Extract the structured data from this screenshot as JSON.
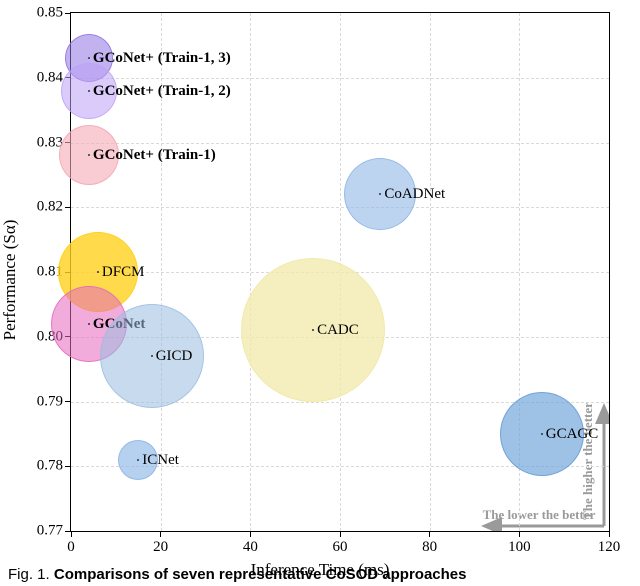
{
  "axes": {
    "xlabel": "Inference Time (ms)",
    "ylabel": "Performance (Sα)",
    "xlim": [
      0,
      120
    ],
    "ylim": [
      0.77,
      0.85
    ],
    "xticks": [
      0,
      20,
      40,
      60,
      80,
      100,
      120
    ],
    "yticks": [
      0.77,
      0.78,
      0.79,
      0.8,
      0.81,
      0.82,
      0.83,
      0.84,
      0.85
    ]
  },
  "hints": {
    "right_up": "The higher the better",
    "right_down": "The lower the better"
  },
  "caption": {
    "prefix": "Fig. 1.",
    "text": "Comparisons of seven representative CoSOD approaches"
  },
  "chart_data": {
    "type": "scatter",
    "title": "",
    "xlabel": "Inference Time (ms)",
    "ylabel": "Performance (Sα)",
    "xlim": [
      0,
      120
    ],
    "ylim": [
      0.77,
      0.85
    ],
    "grid": true,
    "legend": false,
    "series": [
      {
        "name": "GCoNet+ (Train-1, 3)",
        "x": 4,
        "y": 0.843,
        "radius_px": 24,
        "fill": "#8f72e3",
        "alpha": 0.55,
        "label_bold": true,
        "label_dx": 4,
        "label_dy": 0
      },
      {
        "name": "GCoNet+ (Train-1, 2)",
        "x": 4,
        "y": 0.838,
        "radius_px": 28,
        "fill": "#bda1f6",
        "alpha": 0.55,
        "label_bold": true,
        "label_dx": 4,
        "label_dy": 0
      },
      {
        "name": "GCoNet+ (Train-1)",
        "x": 4,
        "y": 0.828,
        "radius_px": 30,
        "fill": "#f5a8b6",
        "alpha": 0.6,
        "label_bold": true,
        "label_dx": 4,
        "label_dy": 0
      },
      {
        "name": "CoADNet",
        "x": 69,
        "y": 0.822,
        "radius_px": 36,
        "fill": "#8fb7e6",
        "alpha": 0.6,
        "label_bold": false,
        "label_dx": 4,
        "label_dy": 0
      },
      {
        "name": "DFCM",
        "x": 6,
        "y": 0.81,
        "radius_px": 40,
        "fill": "#ffd21f",
        "alpha": 0.8,
        "label_bold": false,
        "label_dx": 4,
        "label_dy": 0
      },
      {
        "name": "GCoNet",
        "x": 4,
        "y": 0.802,
        "radius_px": 38,
        "fill": "#e667c0",
        "alpha": 0.55,
        "label_bold": true,
        "label_dx": 4,
        "label_dy": 0
      },
      {
        "name": "CADC",
        "x": 54,
        "y": 0.801,
        "radius_px": 72,
        "fill": "#f2e9aa",
        "alpha": 0.75,
        "label_bold": false,
        "label_dx": 4,
        "label_dy": 0
      },
      {
        "name": "GICD",
        "x": 18,
        "y": 0.797,
        "radius_px": 52,
        "fill": "#9abde0",
        "alpha": 0.55,
        "label_bold": false,
        "label_dx": 4,
        "label_dy": 0
      },
      {
        "name": "GCAGC",
        "x": 105,
        "y": 0.785,
        "radius_px": 42,
        "fill": "#6aa0d8",
        "alpha": 0.65,
        "label_bold": false,
        "label_dx": 4,
        "label_dy": 0
      },
      {
        "name": "ICNet",
        "x": 15,
        "y": 0.781,
        "radius_px": 20,
        "fill": "#8fb7e6",
        "alpha": 0.65,
        "label_bold": false,
        "label_dx": 4,
        "label_dy": 0
      }
    ]
  }
}
